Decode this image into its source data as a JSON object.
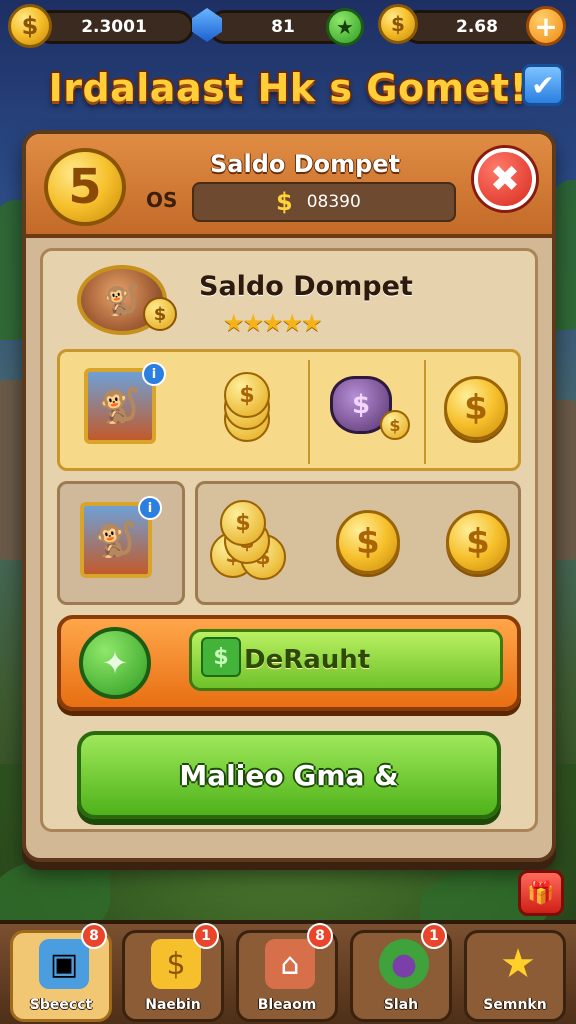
{
  "colors": {
    "accent_gold": "#f6c02c",
    "panel_brown": "#5e3a1d",
    "button_green": "#4fb21a",
    "button_orange": "#e86f12",
    "close_red": "#d82a1d"
  },
  "topbar": {
    "coins": {
      "icon": "coin-icon",
      "value": "2.3001"
    },
    "gems": {
      "icon": "gem-icon",
      "value": "81"
    },
    "gold": {
      "icon": "coin-icon",
      "value": "2.68"
    },
    "add_icon": "plus-icon",
    "star_icon": "star-icon"
  },
  "banner": {
    "title": "Irdalaast Hk s Gomet!",
    "confirm_icon": "checkmark-icon"
  },
  "panel": {
    "title": "Saldo Dompet",
    "badge_text": "5",
    "os_label": "OS",
    "balance_value": "08390",
    "close_icon": "close-icon",
    "profile": {
      "title": "Saldo Dompet",
      "stars": "★★★★★"
    },
    "deposit_label": "DeRauht",
    "play_label": "Malieo Gma &"
  },
  "bottom_nav": [
    {
      "label": "Sbeecct",
      "icon": "chest-icon",
      "badge": "8",
      "active": true
    },
    {
      "label": "Naebin",
      "icon": "coin-stack-icon",
      "badge": "1",
      "active": false
    },
    {
      "label": "Bleaom",
      "icon": "house-icon",
      "badge": "8",
      "active": false
    },
    {
      "label": "Slah",
      "icon": "orb-icon",
      "badge": "1",
      "active": false
    },
    {
      "label": "Semnkn",
      "icon": "star-icon",
      "badge": "",
      "active": false
    }
  ]
}
